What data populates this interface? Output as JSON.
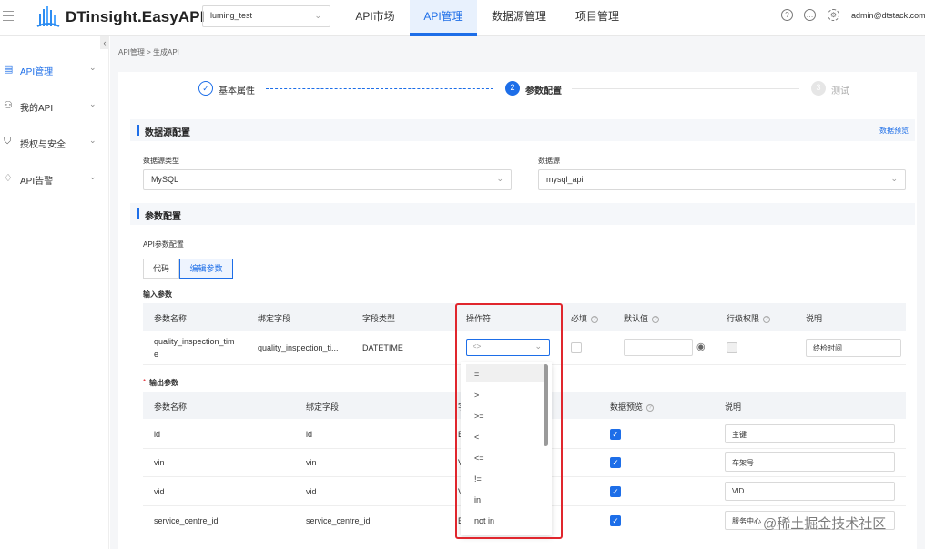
{
  "header": {
    "brand": "DTinsight.EasyAPI",
    "project": "luming_test",
    "nav": [
      "API市场",
      "API管理",
      "数据源管理",
      "项目管理"
    ],
    "active_nav": "API管理",
    "user": "admin@dtstack.com",
    "icons": [
      "help-icon",
      "message-icon",
      "settings-icon"
    ]
  },
  "sidebar": {
    "items": [
      {
        "label": "API管理",
        "icon": "api-icon"
      },
      {
        "label": "我的API",
        "icon": "my-api-icon"
      },
      {
        "label": "授权与安全",
        "icon": "shield-icon"
      },
      {
        "label": "API告警",
        "icon": "bell-icon"
      }
    ]
  },
  "breadcrumb": "API管理 > 生成API",
  "steps": [
    {
      "num": "",
      "label": "基本属性"
    },
    {
      "num": "2",
      "label": "参数配置"
    },
    {
      "num": "3",
      "label": "测试"
    }
  ],
  "datasource": {
    "title": "数据源配置",
    "preview_link": "数据预览",
    "type_label": "数据源类型",
    "type_value": "MySQL",
    "source_label": "数据源",
    "source_value": "mysql_api"
  },
  "params": {
    "title": "参数配置",
    "api_label": "API参数配置",
    "tabs": [
      "代码",
      "编辑参数"
    ],
    "input_label": "输入参数",
    "input_headers": [
      "参数名称",
      "绑定字段",
      "字段类型",
      "操作符",
      "必填",
      "默认值",
      "行级权限",
      "说明"
    ],
    "input_row": {
      "name": "quality_inspection_time",
      "name_l1": "quality_inspection_tim",
      "name_l2": "e",
      "field": "quality_inspection_ti...",
      "type": "DATETIME",
      "operator": "<>",
      "desc": "终检时间"
    },
    "output_label": "输出参数",
    "output_required_mark": "*",
    "output_headers": [
      "参数名称",
      "绑定字段",
      "字",
      "数据预览",
      "说明"
    ],
    "output_rows": [
      {
        "name": "id",
        "field": "id",
        "type": "BI",
        "desc": "主键"
      },
      {
        "name": "vin",
        "field": "vin",
        "type": "VA",
        "desc": "车架号"
      },
      {
        "name": "vid",
        "field": "vid",
        "type": "VA",
        "desc": "VID"
      },
      {
        "name": "service_centre_id",
        "field": "service_centre_id",
        "type": "BI",
        "desc": "服务中心"
      }
    ]
  },
  "operator_options": [
    "=",
    ">",
    ">=",
    "<",
    "<=",
    "!=",
    "in",
    "not in"
  ],
  "watermark": "@稀土掘金技术社区",
  "colors": {
    "accent": "#1d6ee8",
    "highlight": "#e0262d"
  }
}
